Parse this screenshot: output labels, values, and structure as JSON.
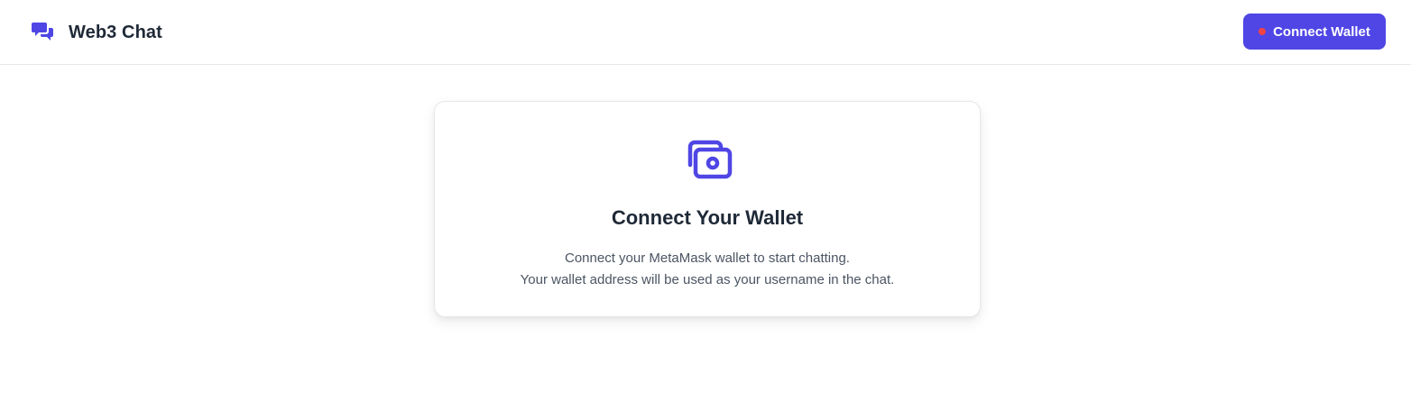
{
  "header": {
    "title": "Web3 Chat",
    "logo_icon": "chat-bubbles-icon",
    "connect_button_label": "Connect Wallet",
    "status_dot_color": "#ef4444"
  },
  "main": {
    "card": {
      "icon": "wallet-cash-icon",
      "title": "Connect Your Wallet",
      "description_line1": "Connect your MetaMask wallet to start chatting.",
      "description_line2": "Your wallet address will be used as your username in the chat."
    }
  },
  "colors": {
    "accent": "#4f46e5",
    "text_primary": "#1f2937",
    "text_secondary": "#4b5563",
    "border": "#e5e7eb"
  }
}
